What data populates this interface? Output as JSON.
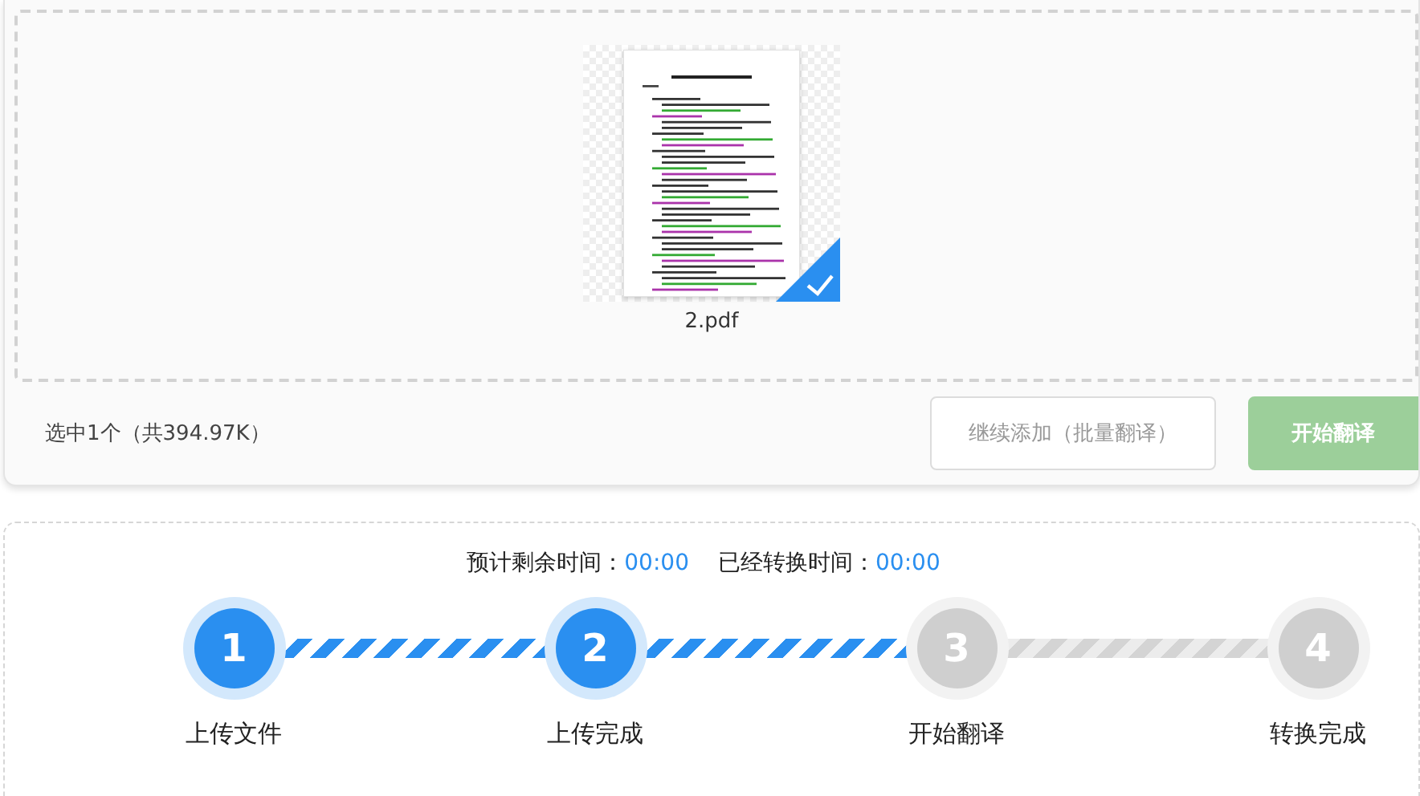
{
  "upload": {
    "file": {
      "name": "2.pdf",
      "selected": true
    },
    "summary": "选中1个（共394.97K）",
    "buttons": [
      {
        "label": "继续添加（批量翻译）",
        "kind": "outline"
      },
      {
        "label": "开始翻译",
        "kind": "primary",
        "disabled": true
      }
    ]
  },
  "progress": {
    "timers": [
      {
        "label": "预计剩余时间：",
        "value": "00:00"
      },
      {
        "label": "已经转换时间：",
        "value": "00:00"
      }
    ],
    "steps": [
      {
        "number": "1",
        "label": "上传文件",
        "done": true
      },
      {
        "number": "2",
        "label": "上传完成",
        "done": true
      },
      {
        "number": "3",
        "label": "开始翻译",
        "done": false
      },
      {
        "number": "4",
        "label": "转换完成",
        "done": false
      }
    ],
    "connectors": [
      {
        "done": true
      },
      {
        "done": true
      },
      {
        "done": false
      }
    ]
  }
}
